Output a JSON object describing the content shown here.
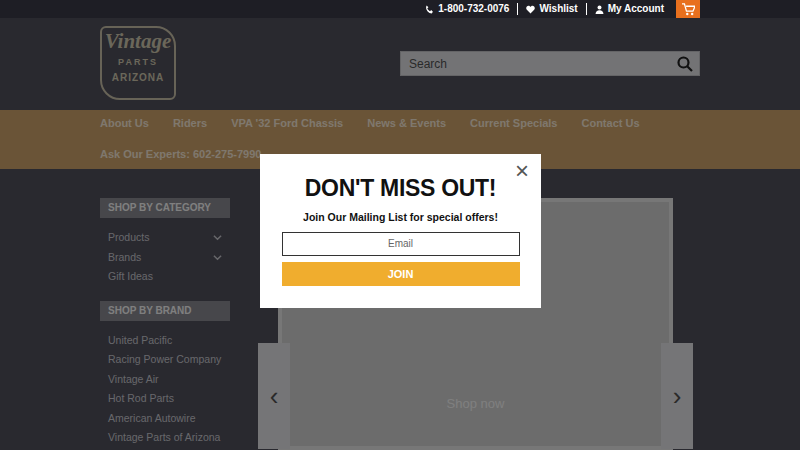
{
  "topbar": {
    "phone": "1-800-732-0076",
    "wishlist": "Wishlist",
    "account": "My Account"
  },
  "logo": {
    "line1": "Vintage",
    "line2": "PARTS",
    "line3": "ARIZONA"
  },
  "search": {
    "placeholder": "Search"
  },
  "nav": {
    "items": [
      "About Us",
      "Riders",
      "VPA '32 Ford Chassis",
      "News & Events",
      "Current Specials",
      "Contact Us"
    ],
    "experts": "Ask Our Experts: 602-275-7990"
  },
  "sidebar": {
    "sections": [
      {
        "title": "SHOP BY CATEGORY",
        "items": [
          {
            "label": "Products",
            "expandable": true
          },
          {
            "label": "Brands",
            "expandable": true
          },
          {
            "label": "Gift Ideas",
            "expandable": false
          }
        ]
      },
      {
        "title": "SHOP BY BRAND",
        "items": [
          {
            "label": "United Pacific",
            "expandable": false
          },
          {
            "label": "Racing Power Company",
            "expandable": false
          },
          {
            "label": "Vintage Air",
            "expandable": false
          },
          {
            "label": "Hot Rod Parts",
            "expandable": false
          },
          {
            "label": "American Autowire",
            "expandable": false
          },
          {
            "label": "Vintage Parts of Arizona",
            "expandable": false
          }
        ]
      }
    ]
  },
  "carousel": {
    "caption": "Shop now",
    "prev": "‹",
    "next": "›"
  },
  "popup": {
    "close": "×",
    "title": "DON'T MISS OUT!",
    "subtitle": "Join Our Mailing List for special offers!",
    "email_placeholder": "Email",
    "button": "JOIN"
  }
}
